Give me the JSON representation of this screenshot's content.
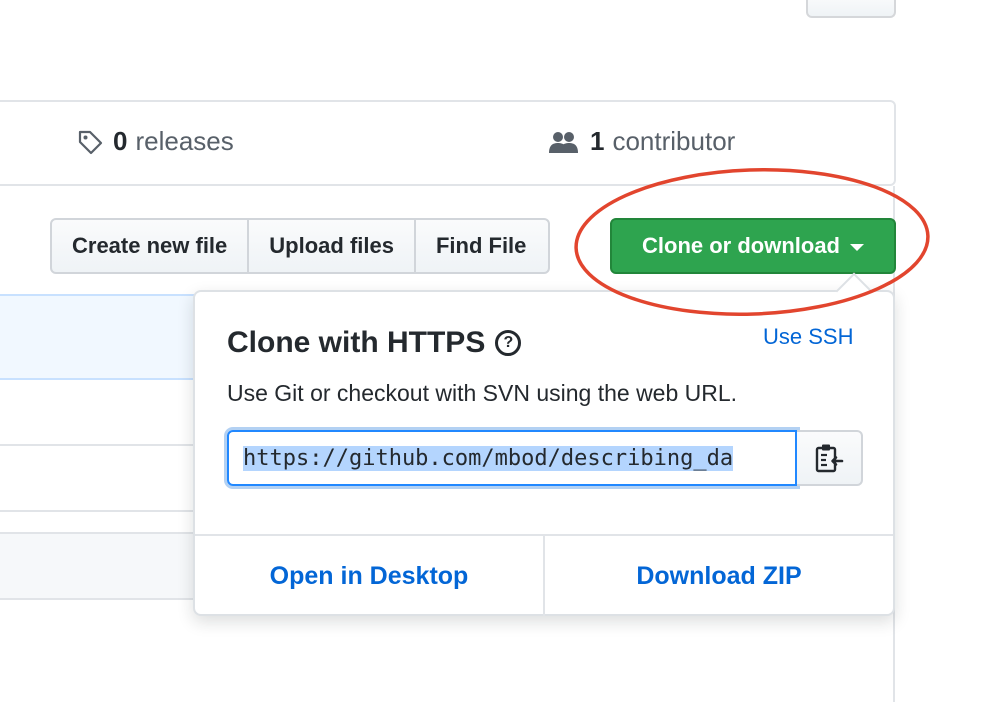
{
  "summary": {
    "releases_count": "0",
    "releases_label": "releases",
    "contributors_count": "1",
    "contributors_label": "contributor"
  },
  "file_nav": {
    "create_new_file": "Create new file",
    "upload_files": "Upload files",
    "find_file": "Find File",
    "clone_or_download": "Clone or download"
  },
  "clone_panel": {
    "title": "Clone with HTTPS",
    "help_symbol": "?",
    "use_ssh": "Use SSH",
    "description": "Use Git or checkout with SVN using the web URL.",
    "url": "https://github.com/mbod/describing_da",
    "open_in_desktop": "Open in Desktop",
    "download_zip": "Download ZIP"
  },
  "colors": {
    "accent_green": "#2ea44f",
    "link_blue": "#0366d6",
    "annotation_red": "#e2452e"
  },
  "icons": {
    "releases": "tag-icon",
    "contributors": "people-icon",
    "copy": "clippy-icon",
    "help": "question-icon",
    "dropdown": "caret-down-icon"
  }
}
